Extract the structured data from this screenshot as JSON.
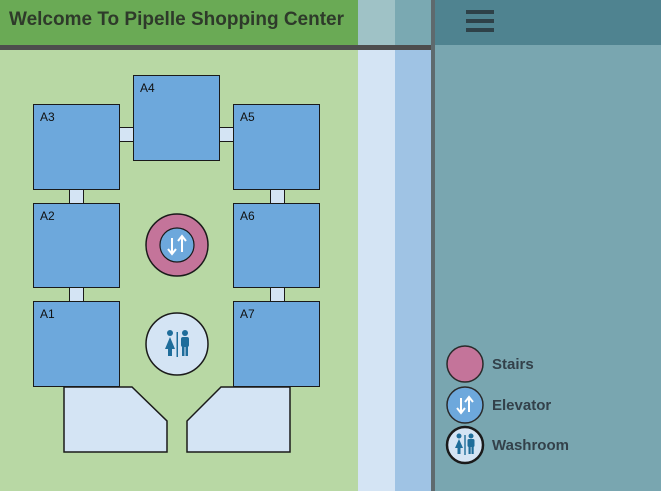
{
  "header": {
    "title": "Welcome To Pipelle Shopping Center"
  },
  "menu": {
    "icon": "hamburger-menu-icon"
  },
  "stores": [
    {
      "id": "A1",
      "label": "A1"
    },
    {
      "id": "A2",
      "label": "A2"
    },
    {
      "id": "A3",
      "label": "A3"
    },
    {
      "id": "A4",
      "label": "A4"
    },
    {
      "id": "A5",
      "label": "A5"
    },
    {
      "id": "A6",
      "label": "A6"
    },
    {
      "id": "A7",
      "label": "A7"
    }
  ],
  "facilities": {
    "elevator": {
      "icon": "elevator-icon"
    },
    "washroom": {
      "icon": "washroom-icon"
    }
  },
  "legend": {
    "items": [
      {
        "key": "stairs",
        "label": "Stairs",
        "color": "#c4749a"
      },
      {
        "key": "elevator",
        "label": "Elevator",
        "color": "#6da8dc"
      },
      {
        "key": "washroom",
        "label": "Washroom",
        "color": "#d4e4f4"
      }
    ]
  },
  "colors": {
    "header": "#6aaa55",
    "map": "#b8d8a4",
    "store": "#6da8dc",
    "panel": "#79a6b0"
  }
}
